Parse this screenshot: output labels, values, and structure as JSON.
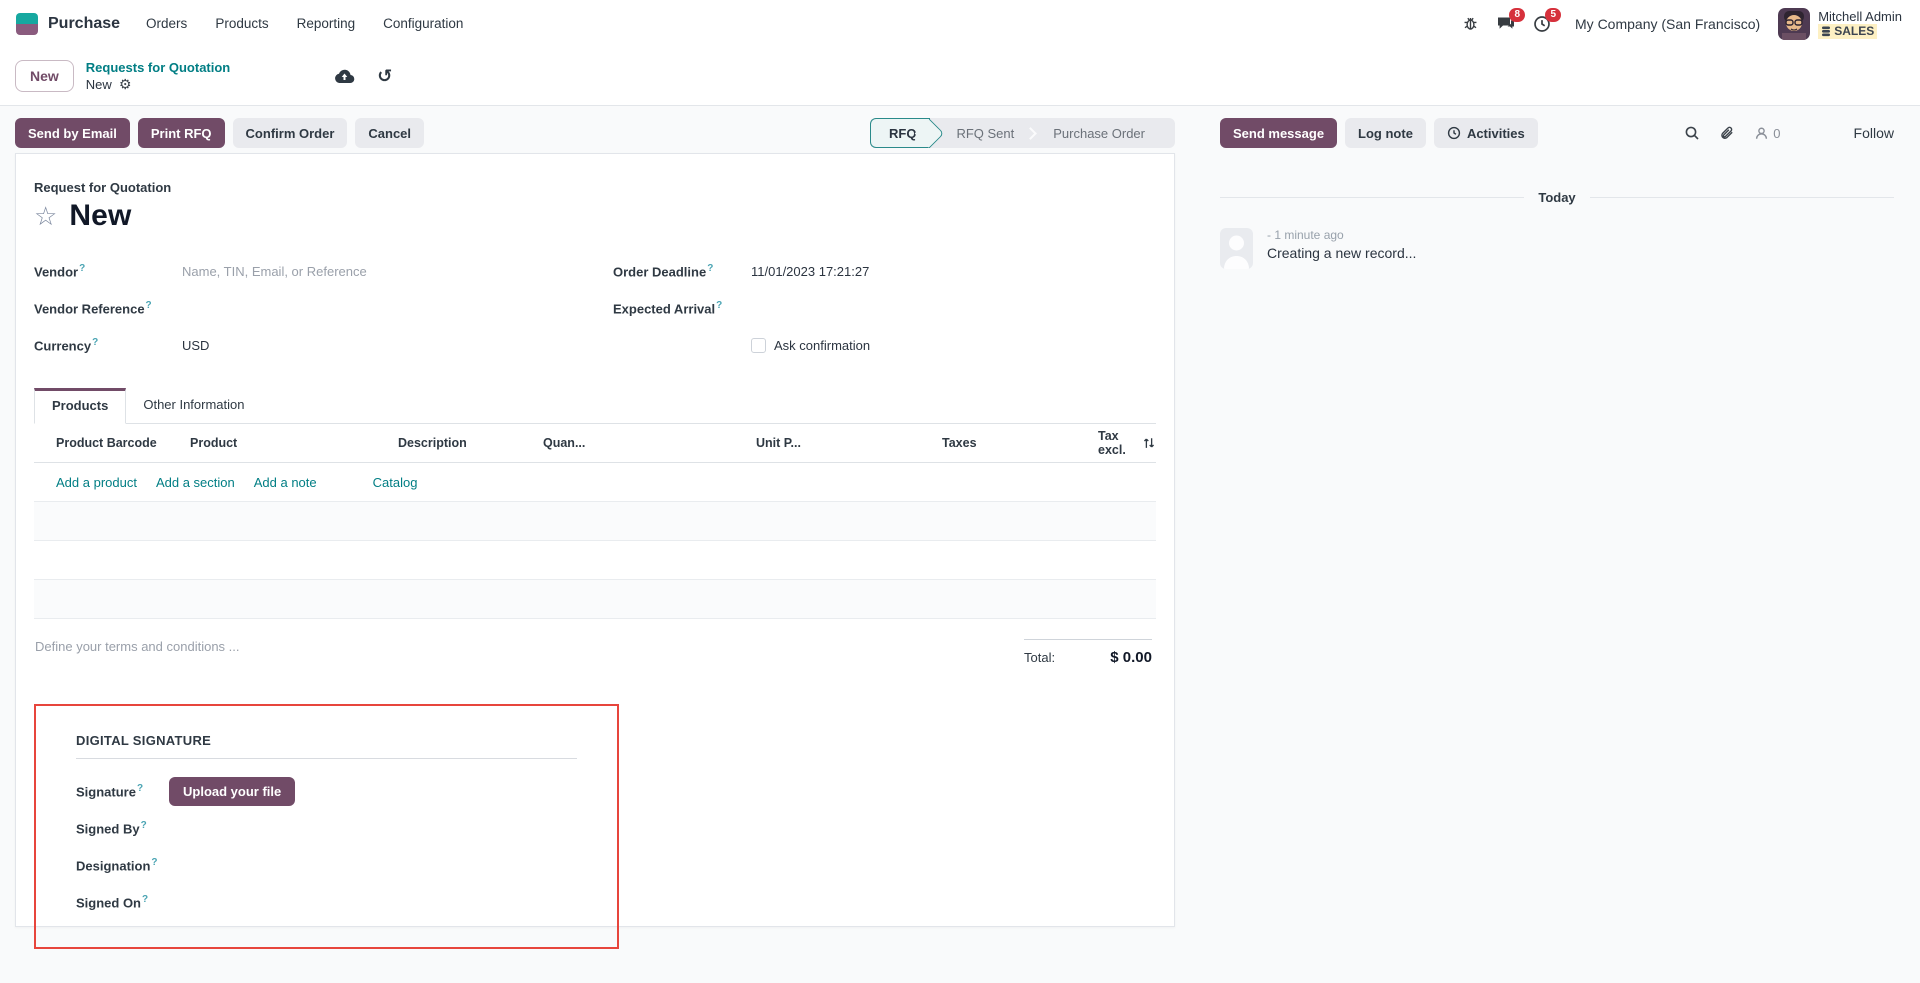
{
  "nav": {
    "app_name": "Purchase",
    "menus": [
      "Orders",
      "Products",
      "Reporting",
      "Configuration"
    ],
    "messages_badge": "8",
    "activities_badge": "5",
    "company": "My Company (San Francisco)",
    "user_name": "Mitchell Admin",
    "user_badge": "SALES"
  },
  "breadcrumb": {
    "new_button": "New",
    "parent": "Requests for Quotation",
    "current": "New"
  },
  "actions": {
    "send_by_email": "Send by Email",
    "print_rfq": "Print RFQ",
    "confirm_order": "Confirm Order",
    "cancel": "Cancel"
  },
  "statusbar": {
    "steps": [
      {
        "label": "RFQ"
      },
      {
        "label": "RFQ Sent"
      },
      {
        "label": "Purchase Order"
      }
    ]
  },
  "form": {
    "doc_label": "Request for Quotation",
    "title": "New",
    "help_marker": "?",
    "vendor_label": "Vendor",
    "vendor_placeholder": "Name, TIN, Email, or Reference",
    "vendor_ref_label": "Vendor Reference",
    "currency_label": "Currency",
    "currency_value": "USD",
    "deadline_label": "Order Deadline",
    "deadline_value": "11/01/2023 17:21:27",
    "arrival_label": "Expected Arrival",
    "ask_confirmation_label": "Ask confirmation",
    "tabs": [
      "Products",
      "Other Information"
    ],
    "columns": [
      "Product Barcode",
      "Product",
      "Description",
      "Quan...",
      "Unit P...",
      "Taxes",
      "Tax excl."
    ],
    "links": [
      "Add a product",
      "Add a section",
      "Add a note",
      "Catalog"
    ],
    "terms_placeholder": "Define your terms and conditions ...",
    "total_label": "Total:",
    "total_value": "$ 0.00"
  },
  "signature": {
    "section_title": "DIGITAL SIGNATURE",
    "signature_label": "Signature",
    "upload_button": "Upload your file",
    "signed_by_label": "Signed By",
    "designation_label": "Designation",
    "signed_on_label": "Signed On"
  },
  "chatter": {
    "send_message": "Send message",
    "log_note": "Log note",
    "activities": "Activities",
    "followers_count": "0",
    "follow": "Follow",
    "today_divider": "Today",
    "message_time": "- 1 minute ago",
    "message_body": "Creating a new record..."
  },
  "colors": {
    "primary": "#714B67",
    "link": "#017e84",
    "highlight": "#e7453c"
  }
}
